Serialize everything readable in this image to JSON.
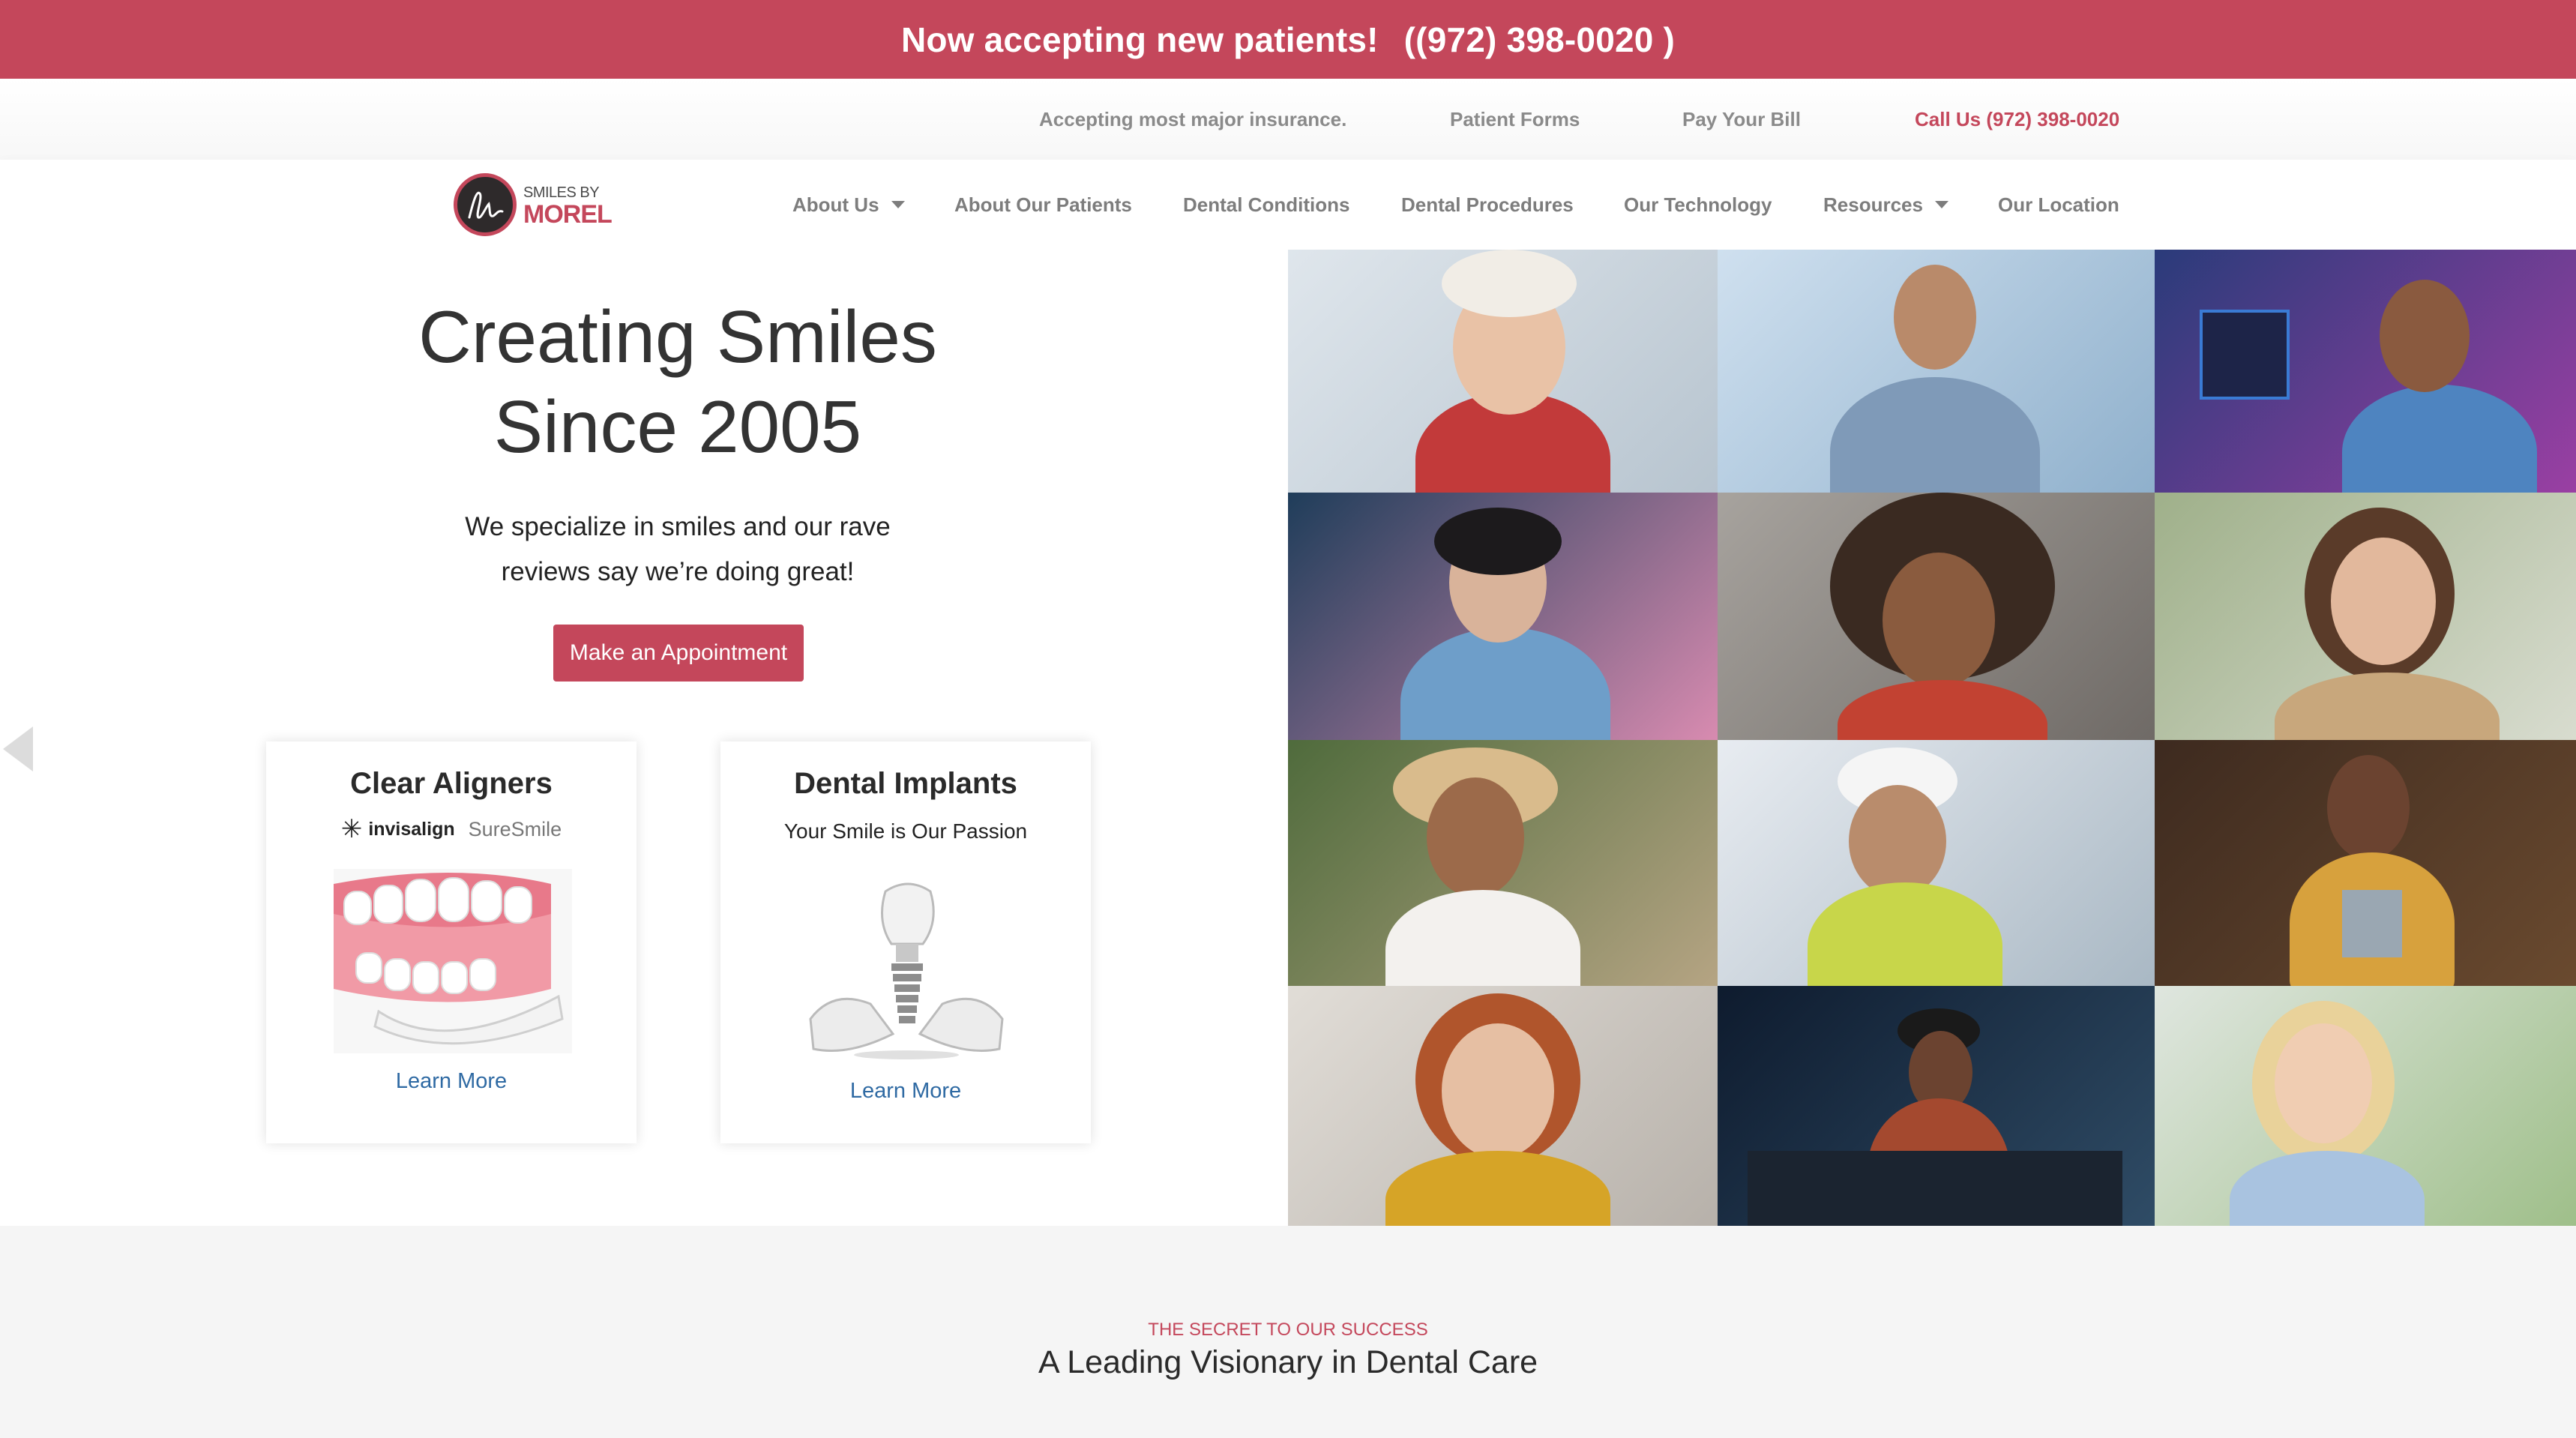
{
  "banner": {
    "text": "Now accepting new patients!",
    "phone": "((972) 398-0020 )"
  },
  "utility": {
    "insurance": "Accepting most major insurance.",
    "patient_forms": "Patient Forms",
    "pay_bill": "Pay Your Bill",
    "call": "Call Us (972) 398-0020"
  },
  "logo": {
    "top": "SMILES BY",
    "name": "MOREL"
  },
  "nav": {
    "items": [
      {
        "label": "About Us"
      },
      {
        "label": "About Our Patients"
      },
      {
        "label": "Dental Conditions"
      },
      {
        "label": "Dental Procedures"
      },
      {
        "label": "Our Technology"
      },
      {
        "label": "Resources"
      },
      {
        "label": "Our Location"
      }
    ]
  },
  "hero": {
    "title_line1": "Creating Smiles",
    "title_line2": "Since 2005",
    "sub_line1": "We specialize in smiles and our rave",
    "sub_line2": "reviews say we’re doing great!",
    "button": "Make an Appointment"
  },
  "cards": [
    {
      "title": "Clear Aligners",
      "brand1": "invisalign",
      "brand2": "SureSmile",
      "learn": "Learn More"
    },
    {
      "title": "Dental Implants",
      "subtitle": "Your Smile is Our Passion",
      "learn": "Learn More"
    }
  ],
  "section": {
    "eyebrow": "THE SECRET TO OUR SUCCESS",
    "heading": "A Leading Visionary in Dental Care"
  },
  "colors": {
    "brand": "#c4475b",
    "link": "#2f6aa3",
    "nav_text": "#7d7d7d"
  }
}
